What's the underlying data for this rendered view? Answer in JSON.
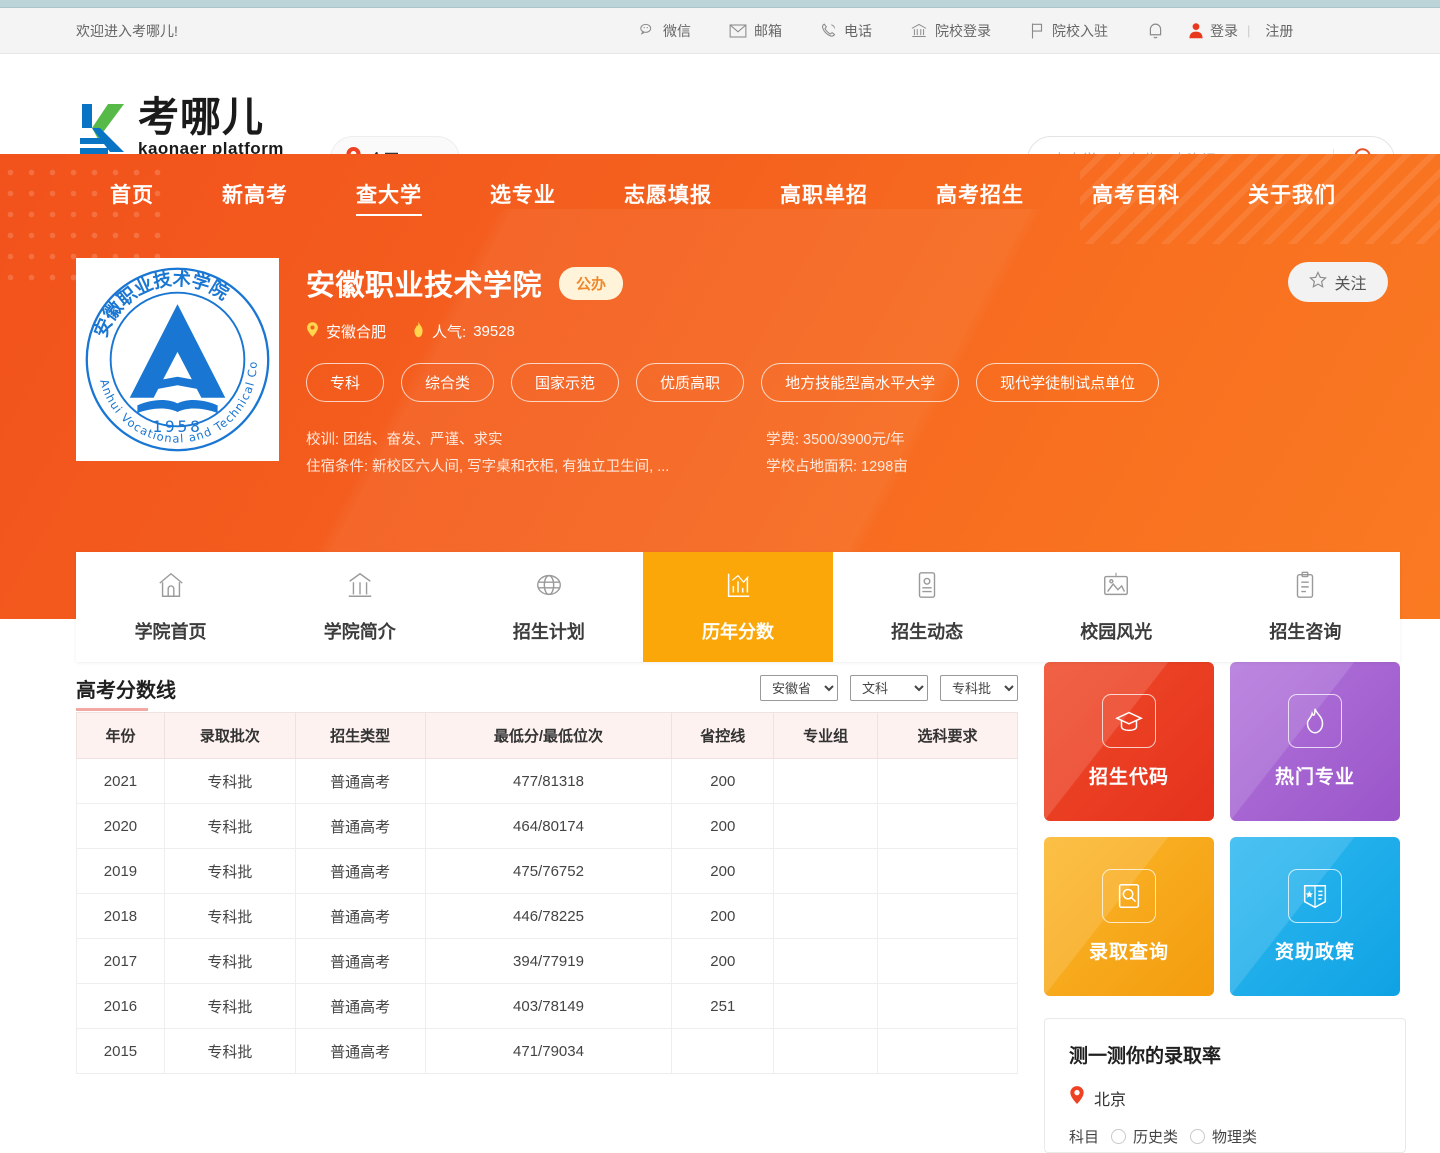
{
  "top_bar": {
    "welcome": "欢迎进入考哪儿!",
    "items": [
      {
        "label": "微信",
        "icon": "wechat-icon"
      },
      {
        "label": "邮箱",
        "icon": "mail-icon"
      },
      {
        "label": "电话",
        "icon": "phone-icon"
      },
      {
        "label": "院校登录",
        "icon": "bank-icon"
      },
      {
        "label": "院校入驻",
        "icon": "flag-icon"
      }
    ],
    "bell_icon": "bell-icon",
    "login": "登录",
    "separator": "|",
    "register": "注册"
  },
  "header": {
    "logo_cn": "考哪儿",
    "logo_en": "kaonaer platform",
    "city": "全国",
    "search_placeholder": "查大学、查专业、查资讯",
    "search_value": ""
  },
  "nav": {
    "items": [
      {
        "label": "首页",
        "active": false
      },
      {
        "label": "新高考",
        "active": false
      },
      {
        "label": "查大学",
        "active": true
      },
      {
        "label": "选专业",
        "active": false
      },
      {
        "label": "志愿填报",
        "active": false
      },
      {
        "label": "高职单招",
        "active": false
      },
      {
        "label": "高考招生",
        "active": false
      },
      {
        "label": "高考百科",
        "active": false
      },
      {
        "label": "关于我们",
        "active": false
      }
    ]
  },
  "school": {
    "name": "安徽职业技术学院",
    "badge": "公办",
    "location": "安徽合肥",
    "popularity_label": "人气:",
    "popularity_value": "39528",
    "tags": [
      "专科",
      "综合类",
      "国家示范",
      "优质高职",
      "地方技能型高水平大学",
      "现代学徒制试点单位"
    ],
    "motto": "校训: 团结、奋发、严谨、求实",
    "dorm": "住宿条件: 新校区六人间, 写字桌和衣柜, 有独立卫生间, ...",
    "tuition": "学费: 3500/3900元/年",
    "area": "学校占地面积: 1298亩",
    "follow_label": "关注",
    "crest_year": "1958",
    "crest_en": "Anhui Vocational and Technical College"
  },
  "tabs": [
    {
      "label": "学院首页",
      "icon": "home-icon",
      "active": false
    },
    {
      "label": "学院简介",
      "icon": "bank-icon",
      "active": false
    },
    {
      "label": "招生计划",
      "icon": "globe-icon",
      "active": false
    },
    {
      "label": "历年分数",
      "icon": "chart-icon",
      "active": true
    },
    {
      "label": "招生动态",
      "icon": "id-card-icon",
      "active": false
    },
    {
      "label": "校园风光",
      "icon": "photo-icon",
      "active": false
    },
    {
      "label": "招生咨询",
      "icon": "clipboard-icon",
      "active": false
    }
  ],
  "scores_panel": {
    "title": "高考分数线",
    "filters": [
      {
        "name": "province",
        "value": "安徽省",
        "options": [
          "安徽省"
        ]
      },
      {
        "name": "subject",
        "value": "文科",
        "options": [
          "文科"
        ]
      },
      {
        "name": "batch",
        "value": "专科批",
        "options": [
          "专科批"
        ]
      }
    ],
    "columns": [
      "年份",
      "录取批次",
      "招生类型",
      "最低分/最低位次",
      "省控线",
      "专业组",
      "选科要求"
    ],
    "rows": [
      {
        "year": "2021",
        "batch": "专科批",
        "type": "普通高考",
        "score": "477/81318",
        "prov_line": "200",
        "group": "",
        "req": ""
      },
      {
        "year": "2020",
        "batch": "专科批",
        "type": "普通高考",
        "score": "464/80174",
        "prov_line": "200",
        "group": "",
        "req": ""
      },
      {
        "year": "2019",
        "batch": "专科批",
        "type": "普通高考",
        "score": "475/76752",
        "prov_line": "200",
        "group": "",
        "req": ""
      },
      {
        "year": "2018",
        "batch": "专科批",
        "type": "普通高考",
        "score": "446/78225",
        "prov_line": "200",
        "group": "",
        "req": ""
      },
      {
        "year": "2017",
        "batch": "专科批",
        "type": "普通高考",
        "score": "394/77919",
        "prov_line": "200",
        "group": "",
        "req": ""
      },
      {
        "year": "2016",
        "batch": "专科批",
        "type": "普通高考",
        "score": "403/78149",
        "prov_line": "251",
        "group": "",
        "req": ""
      },
      {
        "year": "2015",
        "batch": "专科批",
        "type": "普通高考",
        "score": "471/79034",
        "prov_line": "",
        "group": "",
        "req": ""
      }
    ]
  },
  "sidebar": {
    "quick_cards": [
      {
        "label": "招生代码",
        "icon": "graduation-cap-icon",
        "color": "#ea3c23"
      },
      {
        "label": "热门专业",
        "icon": "flame-icon",
        "color": "#a05fce"
      },
      {
        "label": "录取查询",
        "icon": "search-doc-icon",
        "color": "#f7a51b"
      },
      {
        "label": "资助政策",
        "icon": "book-badge-icon",
        "color": "#1aaaea"
      }
    ],
    "rate_card": {
      "title": "测一测你的录取率",
      "location": "北京",
      "subject_label": "科目",
      "options": [
        "历史类",
        "物理类"
      ]
    }
  }
}
